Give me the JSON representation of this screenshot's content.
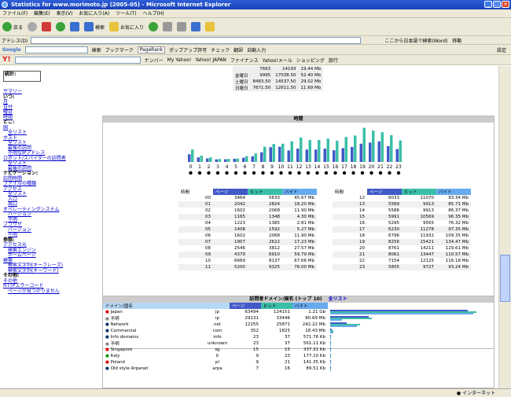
{
  "window": {
    "title": "Statistics for www.morimoto.jp (2005-05) - Microsoft Internet Explorer"
  },
  "menu": [
    "ファイル(F)",
    "編集(E)",
    "表示(V)",
    "お気に入り(A)",
    "ツール(T)",
    "ヘルプ(H)"
  ],
  "toolbar": {
    "back": "戻る",
    "search": "検索",
    "favorites": "お気に入り"
  },
  "address": {
    "label": "アドレス(D)",
    "go": "移動",
    "hint": "ここから日本語で検索(Word)"
  },
  "google": {
    "label": "Google",
    "search": "検索",
    "bookmarks": "ブックマーク",
    "pagerank": "PageRank",
    "popup": "ポップアップ許可",
    "check": "チェック",
    "translate": "翻訳",
    "autofill": "自動入力",
    "settings": "設定"
  },
  "yahoo": {
    "label": "Y!",
    "links": [
      "ナンバー",
      "My Yahoo!",
      "Yahoo! JAPAN",
      "ファイナンス",
      "Yahoo!メール",
      "ショッピング",
      "旅行"
    ]
  },
  "left": {
    "box_title": "統計:",
    "items": [
      {
        "text": "サマリー",
        "style": "nav"
      },
      {
        "text": "いつ:",
        "style": "b"
      },
      {
        "text": "月",
        "style": "nav"
      },
      {
        "text": "日付",
        "style": "nav"
      },
      {
        "text": "曜日",
        "style": "nav"
      },
      {
        "text": "時間",
        "style": "nav"
      },
      {
        "text": "どこ:",
        "style": "b"
      },
      {
        "text": "国",
        "style": "nav"
      },
      {
        "text": "全リスト",
        "style": "i"
      },
      {
        "text": "ホスト",
        "style": "nav"
      },
      {
        "text": "全リスト",
        "style": "i"
      },
      {
        "text": "最後の訪問",
        "style": "i"
      },
      {
        "text": "不明なIPアドレス",
        "style": "i"
      },
      {
        "text": "ロボット/スパイダーの訪問者",
        "style": "nav"
      },
      {
        "text": "全リスト",
        "style": "i"
      },
      {
        "text": "最後の訪問",
        "style": "i"
      },
      {
        "text": "ナビゲーション:",
        "style": "b"
      },
      {
        "text": "訪問時間",
        "style": "nav"
      },
      {
        "text": "ファイルの種類",
        "style": "nav"
      },
      {
        "text": "アクセス",
        "style": "nav"
      },
      {
        "text": "全リスト",
        "style": "i"
      },
      {
        "text": "入口",
        "style": "i"
      },
      {
        "text": "出口",
        "style": "i"
      },
      {
        "text": "オペレーティングシステム",
        "style": "nav"
      },
      {
        "text": "バージョン",
        "style": "i"
      },
      {
        "text": "不明",
        "style": "i"
      },
      {
        "text": "ブラウザ",
        "style": "nav"
      },
      {
        "text": "バージョン",
        "style": "i"
      },
      {
        "text": "不明",
        "style": "i"
      },
      {
        "text": "参照:",
        "style": "b"
      },
      {
        "text": "アクセス元",
        "style": "nav"
      },
      {
        "text": "検索エンジン",
        "style": "i"
      },
      {
        "text": "ホームページ",
        "style": "i"
      },
      {
        "text": "検索",
        "style": "nav"
      },
      {
        "text": "検索文字列(キーフレーズ)",
        "style": "i"
      },
      {
        "text": "検索文字列(キーワード)",
        "style": "i"
      },
      {
        "text": "その他:",
        "style": "b"
      },
      {
        "text": "その他",
        "style": "nav"
      },
      {
        "text": "HTTPエラーコード",
        "style": "nav"
      },
      {
        "text": "ページが見つかりません",
        "style": "i"
      }
    ]
  },
  "days_table": [
    {
      "day": "",
      "pages": "7663",
      "hits": "14193",
      "bw": "19.44 Mb"
    },
    {
      "day": "金曜日",
      "pages": "9995",
      "hits": "17038.50",
      "bw": "52.40 Mb"
    },
    {
      "day": "土曜日",
      "pages": "8483.50",
      "hits": "14537.50",
      "bw": "29.02 Mb"
    },
    {
      "day": "日曜日",
      "pages": "7671.50",
      "hits": "12611.50",
      "bw": "11.69 Mb"
    }
  ],
  "hours": {
    "title": "時間",
    "col_hour": "時間",
    "col_pages": "ページ",
    "col_hits": "ヒット",
    "col_bw": "バイト",
    "colors": {
      "pages": "#4259c8",
      "hits": "#3bbfa8",
      "bw": "#66aaee"
    }
  },
  "chart_data": {
    "type": "bar",
    "categories": [
      "0",
      "1",
      "2",
      "3",
      "4",
      "5",
      "6",
      "7",
      "8",
      "9",
      "10",
      "11",
      "12",
      "13",
      "14",
      "15",
      "16",
      "17",
      "18",
      "19",
      "20",
      "21",
      "22",
      "23"
    ],
    "series": [
      {
        "name": "ページ",
        "values": [
          3464,
          2042,
          1602,
          1165,
          1223,
          1408,
          1907,
          2546,
          4379,
          6669,
          6869,
          5200,
          6033,
          5589,
          5586,
          5991,
          5295,
          6230,
          6796,
          8256,
          8761,
          9304,
          7154,
          5805
        ]
      },
      {
        "name": "ヒット",
        "values": [
          5633,
          2824,
          2068,
          1348,
          1385,
          1592,
          2622,
          3812,
          6910,
          8137,
          8237,
          9325,
          11070,
          9913,
          9913,
          10569,
          9565,
          11278,
          11932,
          15421,
          14211,
          13447,
          12125,
          9727
        ]
      }
    ],
    "rows": [
      {
        "hour": "00",
        "pages": "3464",
        "hits": "5633",
        "bw": "45.67 Mb"
      },
      {
        "hour": "01",
        "pages": "2042",
        "hits": "2824",
        "bw": "18.20 Mb"
      },
      {
        "hour": "02",
        "pages": "1602",
        "hits": "2068",
        "bw": "11.90 Mb"
      },
      {
        "hour": "03",
        "pages": "1165",
        "hits": "1348",
        "bw": "4.30 Mb"
      },
      {
        "hour": "04",
        "pages": "1223",
        "hits": "1385",
        "bw": "2.81 Mb"
      },
      {
        "hour": "05",
        "pages": "1408",
        "hits": "1592",
        "bw": "5.27 Mb"
      },
      {
        "hour": "06",
        "pages": "1602",
        "hits": "2068",
        "bw": "11.90 Mb"
      },
      {
        "hour": "07",
        "pages": "1907",
        "hits": "2622",
        "bw": "17.23 Mb"
      },
      {
        "hour": "08",
        "pages": "2546",
        "hits": "3812",
        "bw": "27.57 Mb"
      },
      {
        "hour": "09",
        "pages": "4379",
        "hits": "6910",
        "bw": "59.79 Mb"
      },
      {
        "hour": "10",
        "pages": "6669",
        "hits": "8137",
        "bw": "67.66 Mb"
      },
      {
        "hour": "11",
        "pages": "5200",
        "hits": "9325",
        "bw": "78.00 Mb"
      }
    ],
    "rows2": [
      {
        "hour": "12",
        "pages": "6033",
        "hits": "11070",
        "bw": "93.34 Mb"
      },
      {
        "hour": "13",
        "pages": "5589",
        "hits": "9913",
        "bw": "85.71 Mb"
      },
      {
        "hour": "14",
        "pages": "5586",
        "hits": "9913",
        "bw": "86.37 Mb"
      },
      {
        "hour": "15",
        "pages": "5991",
        "hits": "10569",
        "bw": "96.35 Mb"
      },
      {
        "hour": "16",
        "pages": "5295",
        "hits": "9565",
        "bw": "76.32 Mb"
      },
      {
        "hour": "17",
        "pages": "6230",
        "hits": "11278",
        "bw": "97.35 Mb"
      },
      {
        "hour": "18",
        "pages": "6796",
        "hits": "11932",
        "bw": "109.35 Mb"
      },
      {
        "hour": "19",
        "pages": "8256",
        "hits": "15421",
        "bw": "134.47 Mb"
      },
      {
        "hour": "20",
        "pages": "8761",
        "hits": "14211",
        "bw": "129.61 Mb"
      },
      {
        "hour": "21",
        "pages": "8061",
        "hits": "13447",
        "bw": "110.57 Mb"
      },
      {
        "hour": "22",
        "pages": "7154",
        "hits": "12125",
        "bw": "116.18 Mb"
      },
      {
        "hour": "23",
        "pages": "5805",
        "hits": "9727",
        "bw": "93.24 Mb"
      }
    ]
  },
  "domains": {
    "title": "訪問者ドメイン/国名 (トップ 10)",
    "full_list": "全リスト",
    "col_domain": "ドメイン/国名",
    "col_pages": "ページ",
    "col_hits": "ヒット",
    "col_bw": "バイト",
    "rows": [
      {
        "name": "Japan",
        "code": "jp",
        "pages": "63494",
        "hits": "124151",
        "bw": "1.21 Gb",
        "pw": 0.92,
        "hw": 0.98,
        "bwv": 0.96
      },
      {
        "name": "不明",
        "code": "ip",
        "pages": "29131",
        "hits": "33446",
        "bw": "80.69 Mb",
        "pw": 0.26,
        "hw": 0.28,
        "bwv": 0.08
      },
      {
        "name": "Network",
        "code": "net",
        "pages": "12255",
        "hits": "25871",
        "bw": "242.22 Mb",
        "pw": 0.11,
        "hw": 0.2,
        "bwv": 0.18
      },
      {
        "name": "Commercial",
        "code": "com",
        "pages": "352",
        "hits": "1825",
        "bw": "18.43 Mb",
        "pw": 0.01,
        "hw": 0.02,
        "bwv": 0.02
      },
      {
        "name": "Info domains",
        "code": "info",
        "pages": "23",
        "hits": "37",
        "bw": "571.76 Kb",
        "pw": 0.003,
        "hw": 0.003,
        "bwv": 0.003
      },
      {
        "name": "不明",
        "code": "unknown",
        "pages": "23",
        "hits": "37",
        "bw": "561.11 Kb",
        "pw": 0.003,
        "hw": 0.003,
        "bwv": 0.003
      },
      {
        "name": "Singapore",
        "code": "sg",
        "pages": "15",
        "hits": "15",
        "bw": "337.31 Kb",
        "pw": 0.003,
        "hw": 0.003,
        "bwv": 0.003
      },
      {
        "name": "Italy",
        "code": "it",
        "pages": "9",
        "hits": "23",
        "bw": "177.10 Kb",
        "pw": 0.003,
        "hw": 0.003,
        "bwv": 0.003
      },
      {
        "name": "Poland",
        "code": "pl",
        "pages": "9",
        "hits": "21",
        "bw": "141.35 Kb",
        "pw": 0.003,
        "hw": 0.003,
        "bwv": 0.003
      },
      {
        "name": "Old style Arpanet",
        "code": "arpa",
        "pages": "7",
        "hits": "16",
        "bw": "89.51 Kb",
        "pw": 0.003,
        "hw": 0.003,
        "bwv": 0.003
      }
    ]
  },
  "status": {
    "done": "",
    "zone": "インターネット"
  }
}
